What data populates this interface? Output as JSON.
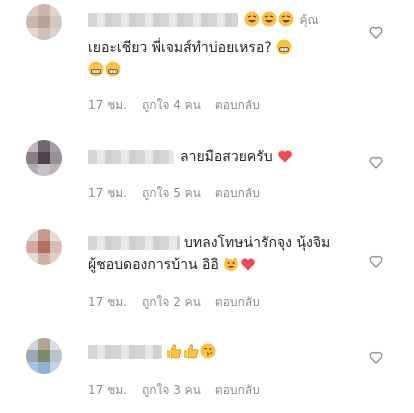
{
  "comments": [
    {
      "line1_trail": "คุ้ณ",
      "line1_emojis": [
        "rolling-laughing-emoji",
        "rolling-laughing-emoji",
        "rolling-laughing-emoji"
      ],
      "line2_text": "เยอะเชียว  พี่เจมส์ทำบ่อยเหรอ?",
      "line2_emojis": [
        "grimacing-emoji"
      ],
      "line3_emojis": [
        "grimacing-emoji",
        "grimacing-emoji"
      ],
      "time": "17 ชม.",
      "likes": "ถูกใจ 4 คน",
      "reply": "ตอบกลับ"
    },
    {
      "text": "ลายมือสวยครับ",
      "emojis": [
        "sparkling-heart-emoji"
      ],
      "time": "17 ชม.",
      "likes": "ถูกใจ 5 คน",
      "reply": "ตอบกลับ"
    },
    {
      "line1_text": "บทลงโทษน่ารักจุง  นุ้งจิม",
      "line2_text": "ผู้ชอบดองการบ้าน  อิอิ",
      "line2_emojis": [
        "grinning-cat-emoji",
        "red-heart-emoji"
      ],
      "time": "17 ชม.",
      "likes": "ถูกใจ 2 คน",
      "reply": "ตอบกลับ"
    },
    {
      "emojis": [
        "thumbs-up-emoji",
        "thumbs-up-emoji",
        "face-blowing-kiss-emoji"
      ],
      "time": "17 ชม.",
      "likes": "ถูกใจ 3 คน",
      "reply": "ตอบกลับ"
    }
  ],
  "colors": {
    "text": "#262626",
    "meta": "#8e8e8e",
    "heart_outline": "#8e8e8e",
    "emoji_yellow": "#f6c343",
    "red": "#ed4956"
  },
  "icons": {
    "like": "heart-outline-icon"
  }
}
